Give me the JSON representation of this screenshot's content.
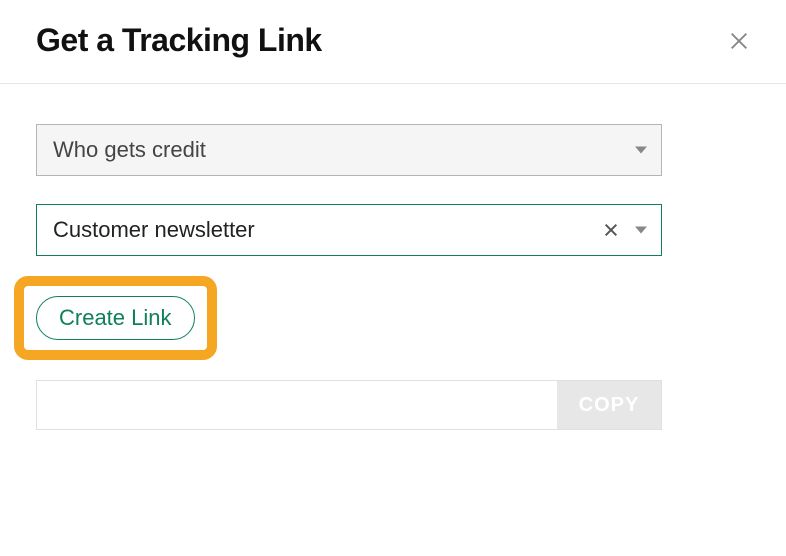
{
  "header": {
    "title": "Get a Tracking Link"
  },
  "form": {
    "credit_select": {
      "placeholder": "Who gets credit"
    },
    "source_select": {
      "value": "Customer newsletter"
    },
    "create_button": "Create Link",
    "output_value": "",
    "copy_button": "COPY"
  }
}
